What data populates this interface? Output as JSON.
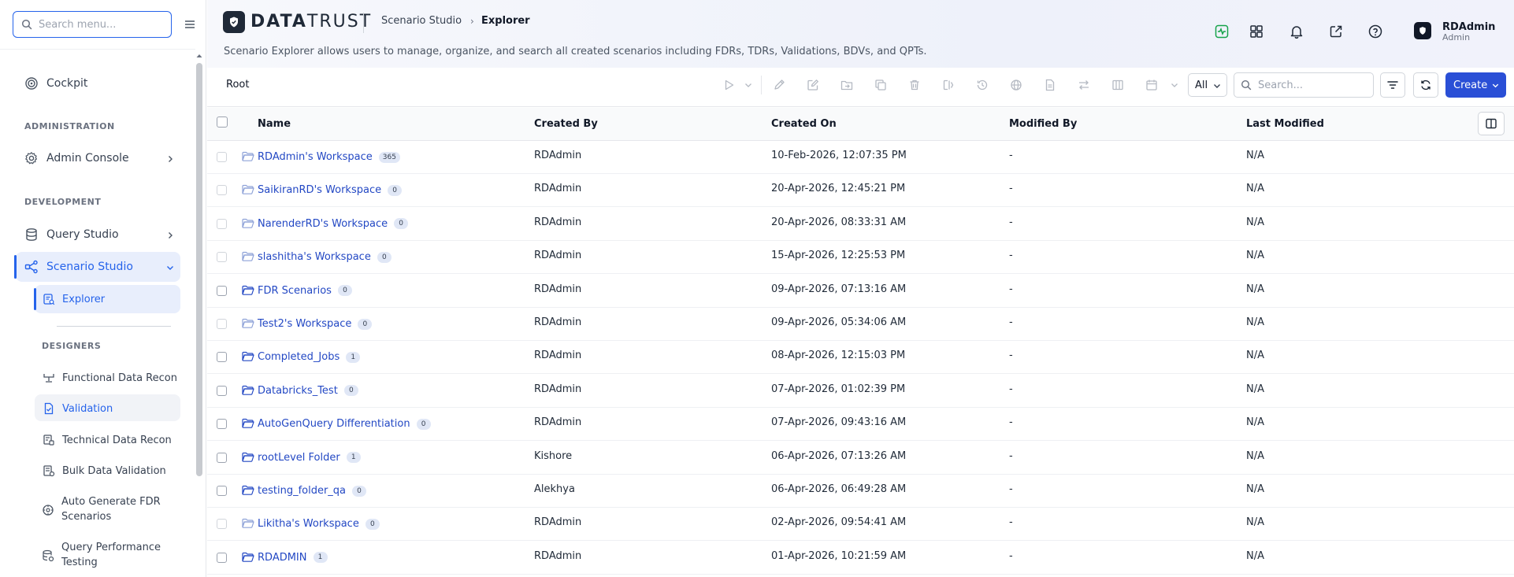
{
  "sidebar": {
    "search_placeholder": "Search menu...",
    "cockpit": "Cockpit",
    "section_admin": "ADMINISTRATION",
    "admin_console": "Admin Console",
    "section_dev": "DEVELOPMENT",
    "query_studio": "Query Studio",
    "scenario_studio": "Scenario Studio",
    "explorer": "Explorer",
    "section_designers": "DESIGNERS",
    "designers": [
      {
        "label": "Functional Data Recon",
        "icon": "recon-icon"
      },
      {
        "label": "Validation",
        "icon": "validation-icon"
      },
      {
        "label": "Technical Data Recon",
        "icon": "tech-recon-icon"
      },
      {
        "label": "Bulk Data Validation",
        "icon": "bulk-validation-icon"
      },
      {
        "label": "Auto Generate FDR",
        "label2": "Scenarios",
        "icon": "auto-generate-icon"
      },
      {
        "label": "Query Performance",
        "label2": "Testing",
        "icon": "query-performance-icon"
      }
    ]
  },
  "header": {
    "logo_bold": "DATA",
    "logo_rest": "TRUST",
    "breadcrumb_parent": "Scenario Studio",
    "breadcrumb_sep": "›",
    "breadcrumb_current": "Explorer",
    "description": "Scenario Explorer allows users to manage, organize, and search all created scenarios including FDRs, TDRs, Validations, BDVs, and QPTs.",
    "user_name": "RDAdmin",
    "user_role": "Admin",
    "accent_color": "#2a4fd6"
  },
  "toolbar": {
    "root_label": "Root",
    "filter_value": "All",
    "search_placeholder": "Search...",
    "create_label": "Create"
  },
  "table": {
    "columns": [
      "Name",
      "Created By",
      "Created On",
      "Modified By",
      "Last Modified"
    ],
    "rows": [
      {
        "name": "RDAdmin's Workspace",
        "count": "365",
        "created_by": "RDAdmin",
        "created_on": "10-Feb-2026, 12:07:35 PM",
        "modified_by": "-",
        "last_modified": "N/A",
        "shared": false
      },
      {
        "name": "SaikiranRD's Workspace",
        "count": "0",
        "created_by": "RDAdmin",
        "created_on": "20-Apr-2026, 12:45:21 PM",
        "modified_by": "-",
        "last_modified": "N/A",
        "shared": false
      },
      {
        "name": "NarenderRD's Workspace",
        "count": "0",
        "created_by": "RDAdmin",
        "created_on": "20-Apr-2026, 08:33:31 AM",
        "modified_by": "-",
        "last_modified": "N/A",
        "shared": false
      },
      {
        "name": "slashitha's Workspace",
        "count": "0",
        "created_by": "RDAdmin",
        "created_on": "15-Apr-2026, 12:25:53 PM",
        "modified_by": "-",
        "last_modified": "N/A",
        "shared": false
      },
      {
        "name": "FDR Scenarios",
        "count": "0",
        "created_by": "RDAdmin",
        "created_on": "09-Apr-2026, 07:13:16 AM",
        "modified_by": "-",
        "last_modified": "N/A",
        "shared": true
      },
      {
        "name": "Test2's Workspace",
        "count": "0",
        "created_by": "RDAdmin",
        "created_on": "09-Apr-2026, 05:34:06 AM",
        "modified_by": "-",
        "last_modified": "N/A",
        "shared": false
      },
      {
        "name": "Completed_Jobs",
        "count": "1",
        "created_by": "RDAdmin",
        "created_on": "08-Apr-2026, 12:15:03 PM",
        "modified_by": "-",
        "last_modified": "N/A",
        "shared": true
      },
      {
        "name": "Databricks_Test",
        "count": "0",
        "created_by": "RDAdmin",
        "created_on": "07-Apr-2026, 01:02:39 PM",
        "modified_by": "-",
        "last_modified": "N/A",
        "shared": true
      },
      {
        "name": "AutoGenQuery Differentiation",
        "count": "0",
        "created_by": "RDAdmin",
        "created_on": "07-Apr-2026, 09:43:16 AM",
        "modified_by": "-",
        "last_modified": "N/A",
        "shared": true
      },
      {
        "name": "rootLevel Folder",
        "count": "1",
        "created_by": "Kishore",
        "created_on": "06-Apr-2026, 07:13:26 AM",
        "modified_by": "-",
        "last_modified": "N/A",
        "shared": true
      },
      {
        "name": "testing_folder_qa",
        "count": "0",
        "created_by": "Alekhya",
        "created_on": "06-Apr-2026, 06:49:28 AM",
        "modified_by": "-",
        "last_modified": "N/A",
        "shared": true
      },
      {
        "name": "Likitha's Workspace",
        "count": "0",
        "created_by": "RDAdmin",
        "created_on": "02-Apr-2026, 09:54:41 AM",
        "modified_by": "-",
        "last_modified": "N/A",
        "shared": false
      },
      {
        "name": "RDADMIN",
        "count": "1",
        "created_by": "RDAdmin",
        "created_on": "01-Apr-2026, 10:21:59 AM",
        "modified_by": "-",
        "last_modified": "N/A",
        "shared": true
      }
    ]
  }
}
